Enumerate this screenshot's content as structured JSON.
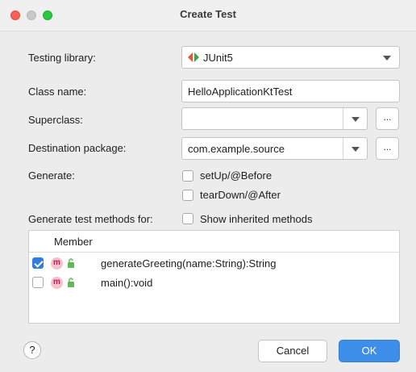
{
  "window": {
    "title": "Create Test"
  },
  "form": {
    "testing_library": {
      "label": "Testing library:",
      "value": "JUnit5"
    },
    "class_name": {
      "label": "Class name:",
      "value": "HelloApplicationKtTest"
    },
    "superclass": {
      "label": "Superclass:",
      "value": "",
      "browse_label": "..."
    },
    "destination_package": {
      "label": "Destination package:",
      "value": "com.example.source",
      "browse_label": "..."
    },
    "generate": {
      "label": "Generate:",
      "options": [
        {
          "label": "setUp/@Before",
          "checked": false
        },
        {
          "label": "tearDown/@After",
          "checked": false
        }
      ]
    },
    "test_methods": {
      "label": "Generate test methods for:",
      "show_inherited": {
        "label": "Show inherited methods",
        "checked": false
      }
    }
  },
  "members_table": {
    "header": "Member",
    "rows": [
      {
        "icon": "method-icon",
        "icon_letter": "m",
        "signature": "generateGreeting(name:String):String",
        "checked": true
      },
      {
        "icon": "method-icon",
        "icon_letter": "m",
        "signature": "main():void",
        "checked": false
      }
    ]
  },
  "footer": {
    "help_label": "?",
    "cancel_label": "Cancel",
    "ok_label": "OK"
  },
  "colors": {
    "accent": "#3d8ee8",
    "checkbox_checked": "#2f7de1",
    "method_icon_bg": "#f5c0cc"
  }
}
